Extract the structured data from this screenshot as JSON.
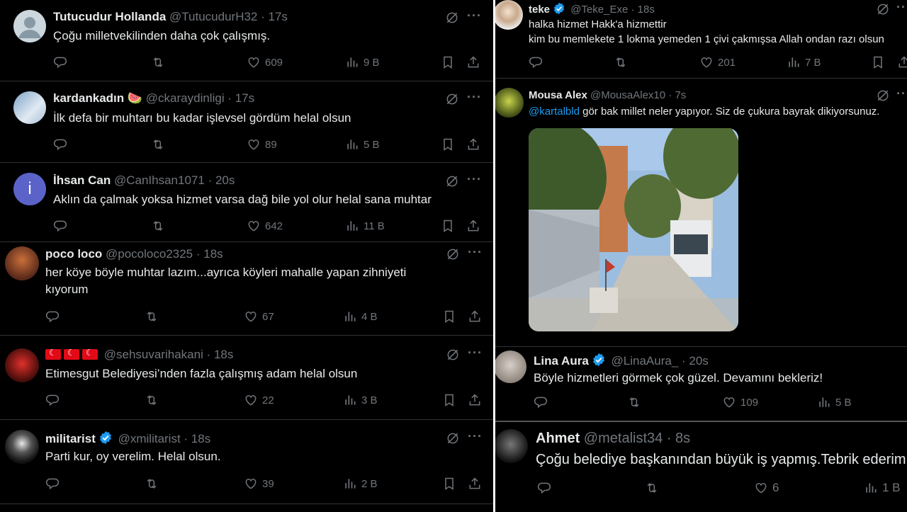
{
  "left_column": [
    {
      "name": "Tutucudur Hollanda",
      "handle": "@TutucudurH32",
      "time": "· 17s",
      "text": "Çoğu milletvekilinden daha çok çalışmış.",
      "replies": "",
      "retweets": "",
      "likes": "609",
      "views": "9 B",
      "avatar": "default-avatar-icon"
    },
    {
      "name": "kardankadın",
      "emoji": "🍉",
      "handle": "@ckaraydinligi",
      "time": "· 17s",
      "text": "İlk defa bir muhtarı bu kadar işlevsel gördüm helal olsun",
      "likes": "89",
      "views": "5 B",
      "avatar": "snowman-avatar"
    },
    {
      "name": "İhsan Can",
      "handle": "@CanIhsan1071",
      "time": "· 20s",
      "text": "Aklın da çalmak yoksa hizmet varsa dağ bile yol olur helal sana muhtar",
      "likes": "642",
      "views": "11 B",
      "avatar_letter": "i",
      "avatar": "letter-avatar"
    },
    {
      "name": "poco loco",
      "handle": "@pocoloco2325",
      "time": "· 18s",
      "text": "her köye böyle muhtar lazım...ayrıca köyleri mahalle yapan zihniyeti kıyorum",
      "likes": "67",
      "views": "4 B",
      "avatar": "cartoon-avatar"
    },
    {
      "name": "",
      "flags": "🇹🇷🇹🇷🇹🇷",
      "handle": "@sehsuvarihakani",
      "time": "· 18s",
      "text": "Etimesgut Belediyesi’nden fazla çalışmış adam helal olsun",
      "likes": "22",
      "views": "3 B",
      "avatar": "red-photo-avatar"
    },
    {
      "name": "militarist",
      "verified": true,
      "handle": "@xmilitarist",
      "time": "· 18s",
      "text": "Parti kur, oy verelim. Helal olsun.",
      "likes": "39",
      "views": "2 B",
      "avatar": "dark-photo-avatar"
    }
  ],
  "right_column": [
    {
      "name": "teke",
      "verified": true,
      "handle": "@Teke_Exe",
      "time": "· 18s",
      "text_lines": [
        "halka hizmet Hakk'a hizmettir",
        "kim bu memlekete 1 lokma yemeden 1 çivi çakmışsa Allah ondan razı olsun"
      ],
      "likes": "201",
      "views": "7 B"
    },
    {
      "name": "Mousa Alex",
      "handle": "@MousaAlex10",
      "time": "· 7s",
      "mention": "@kartalbld",
      "text": " gör bak millet neler yapıyor. Siz de çukura bayrak dikiyorsunuz.",
      "media": "street-photo"
    },
    {
      "name": "Lina Aura",
      "verified": true,
      "handle": "@LinaAura_",
      "time": "· 20s",
      "text": "Böyle hizmetleri görmek çok güzel. Devamını bekleriz!",
      "likes": "109",
      "views": "5 B"
    },
    {
      "name": "Ahmet",
      "handle": "@metalist34",
      "time": "· 8s",
      "text": "Çoğu belediye başkanından büyük iş yapmış.Tebrik ederim",
      "likes": "6",
      "views": "1 B"
    }
  ],
  "colors": {
    "bg": "#000000",
    "text": "#e7e9ea",
    "muted": "#71767b",
    "link": "#1d9bf0",
    "divider": "#2f3336"
  }
}
